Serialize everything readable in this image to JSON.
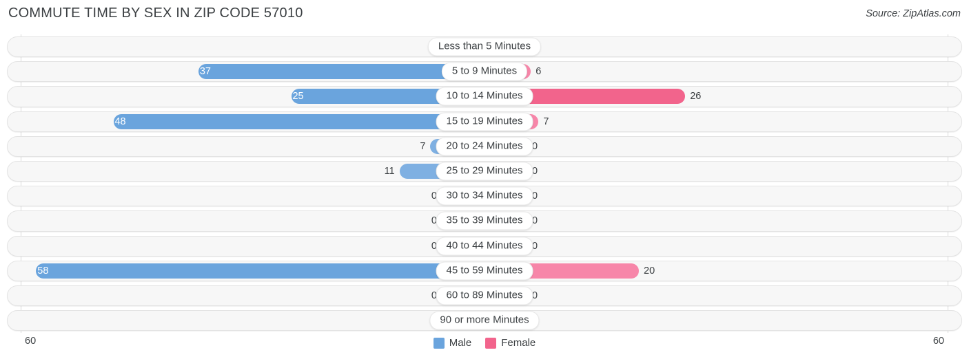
{
  "header": {
    "title": "COMMUTE TIME BY SEX IN ZIP CODE 57010",
    "source": "Source: ZipAtlas.com"
  },
  "legend": {
    "male_label": "Male",
    "female_label": "Female",
    "male_color": "#6aa4dd",
    "female_color": "#f2648c"
  },
  "axis": {
    "left_end": "60",
    "right_end": "60",
    "max": 60
  },
  "chart_data": {
    "type": "bar",
    "orientation": "horizontal-diverging",
    "title": "COMMUTE TIME BY SEX IN ZIP CODE 57010",
    "xlabel": "",
    "ylabel": "",
    "xlim": [
      60,
      60
    ],
    "grid": false,
    "legend_position": "bottom-center",
    "categories": [
      "Less than 5 Minutes",
      "5 to 9 Minutes",
      "10 to 14 Minutes",
      "15 to 19 Minutes",
      "20 to 24 Minutes",
      "25 to 29 Minutes",
      "30 to 34 Minutes",
      "35 to 39 Minutes",
      "40 to 44 Minutes",
      "45 to 59 Minutes",
      "60 to 89 Minutes",
      "90 or more Minutes"
    ],
    "series": [
      {
        "name": "Male",
        "side": "left",
        "color": "#6aa4dd",
        "values": [
          0,
          37,
          25,
          48,
          7,
          11,
          0,
          0,
          0,
          58,
          0,
          0
        ]
      },
      {
        "name": "Female",
        "side": "right",
        "color": "#f2648c",
        "values": [
          0,
          6,
          26,
          7,
          0,
          0,
          0,
          0,
          0,
          20,
          0,
          0
        ]
      }
    ]
  },
  "rows": [
    {
      "category": "Less than 5 Minutes",
      "male": "0",
      "female": "0"
    },
    {
      "category": "5 to 9 Minutes",
      "male": "37",
      "female": "6"
    },
    {
      "category": "10 to 14 Minutes",
      "male": "25",
      "female": "26"
    },
    {
      "category": "15 to 19 Minutes",
      "male": "48",
      "female": "7"
    },
    {
      "category": "20 to 24 Minutes",
      "male": "7",
      "female": "0"
    },
    {
      "category": "25 to 29 Minutes",
      "male": "11",
      "female": "0"
    },
    {
      "category": "30 to 34 Minutes",
      "male": "0",
      "female": "0"
    },
    {
      "category": "35 to 39 Minutes",
      "male": "0",
      "female": "0"
    },
    {
      "category": "40 to 44 Minutes",
      "male": "0",
      "female": "0"
    },
    {
      "category": "45 to 59 Minutes",
      "male": "58",
      "female": "20"
    },
    {
      "category": "60 to 89 Minutes",
      "male": "0",
      "female": "0"
    },
    {
      "category": "90 or more Minutes",
      "male": "0",
      "female": "0"
    }
  ]
}
